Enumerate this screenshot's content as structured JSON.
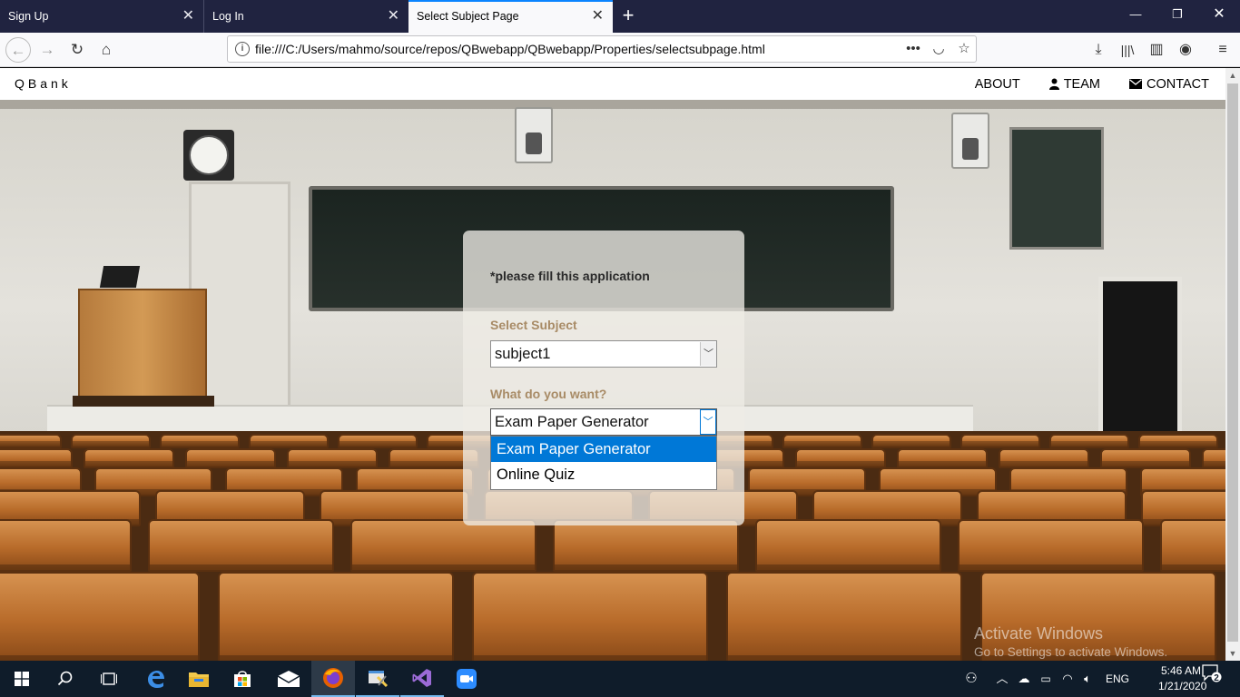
{
  "browser": {
    "tabs": [
      {
        "label": "Sign Up",
        "active": false
      },
      {
        "label": "Log In",
        "active": false
      },
      {
        "label": "Select Subject Page",
        "active": true
      }
    ],
    "url": "file:///C:/Users/mahmo/source/repos/QBwebapp/QBwebapp/Properties/selectsubpage.html"
  },
  "site": {
    "brand": "QBank",
    "menu": [
      {
        "label": "ABOUT",
        "icon": ""
      },
      {
        "label": "TEAM",
        "icon": "user-icon"
      },
      {
        "label": "CONTACT",
        "icon": "envelope-icon"
      }
    ]
  },
  "form": {
    "note": "*please fill this application",
    "subject_label": "Select Subject",
    "subject_value": "subject1",
    "want_label": "What do you want?",
    "want_value": "Exam Paper Generator",
    "want_options": [
      "Exam Paper Generator",
      "Online Quiz"
    ],
    "highlighted_option": "Exam Paper Generator"
  },
  "watermark": {
    "line1": "Activate Windows",
    "line2": "Go to Settings to activate Windows."
  },
  "taskbar": {
    "lang": "ENG",
    "time": "5:46 AM",
    "date": "1/21/2020",
    "notifications": "2"
  },
  "colors": {
    "accent": "#0078d7",
    "label": "#a88b66",
    "tabbar": "#202340",
    "taskbar": "#0f1c2a"
  }
}
